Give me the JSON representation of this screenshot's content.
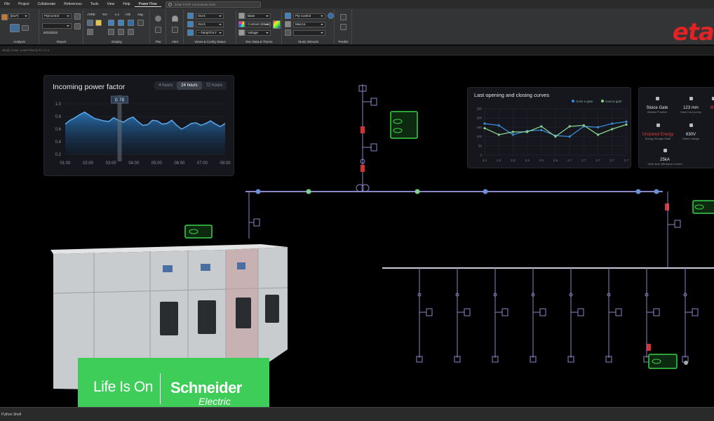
{
  "menu": [
    "File",
    "Project",
    "Collaborate",
    "References",
    "Tools",
    "View",
    "Help",
    "Power Flow"
  ],
  "command_search": {
    "placeholder": "Enter ETAP Commands Here"
  },
  "ribbon": {
    "analysis": {
      "dropdown": "[DLF]",
      "label": "Analysis"
    },
    "report": {
      "dropdown": "PQControl",
      "date": "9/22/2023",
      "label": "Report"
    },
    "display": {
      "items": [
        "√VRE",
        "%V",
        "L-L",
        "√Vb",
        "Avg"
      ],
      "label": "Display"
    },
    "plot": {
      "label": "Plot"
    },
    "alert": {
      "label": "Alert"
    },
    "views": {
      "dropdowns": [
        "OLV1",
        "OLV1",
        "---TampTOLY"
      ],
      "label": "Views & Config Status"
    },
    "rev": {
      "dropdowns": [
        "Base",
        "Contrast (Black)",
        "Voltage"
      ],
      "label": "Rev Data & Theme"
    },
    "study": {
      "dropdowns": [
        "PQ Control",
        "Macro1",
        ""
      ],
      "label": "Study Wizards"
    },
    "predict": {
      "label": "Predict"
    }
  },
  "logo": "eta",
  "substrip": "Study Case: Load Flow (LF) 1.3.1",
  "power_factor": {
    "title": "Incoming power factor",
    "tabs": [
      "4 hours",
      "24 hours",
      "72 hours"
    ],
    "active_tab": 1,
    "cursor_value": "0.78",
    "chart_data": {
      "type": "area",
      "x": [
        "01:00",
        "02:00",
        "03:00",
        "04:00",
        "05:00",
        "06:00",
        "07:00",
        "08:00"
      ],
      "y_ticks": [
        "1.0",
        "0.8",
        "0.6",
        "0.4",
        "0.2"
      ],
      "ylim": [
        0.2,
        1.0
      ],
      "values": [
        0.68,
        0.74,
        0.78,
        0.83,
        0.87,
        0.82,
        0.77,
        0.75,
        0.73,
        0.72,
        0.78,
        0.74,
        0.71,
        0.76,
        0.79,
        0.72,
        0.66,
        0.67,
        0.74,
        0.73,
        0.68,
        0.69,
        0.74,
        0.66,
        0.6,
        0.64,
        0.69,
        0.7,
        0.66,
        0.69,
        0.73,
        0.68,
        0.64,
        0.69
      ]
    }
  },
  "curves": {
    "title": "Last opening and closing curves",
    "legend": [
      "close a gate",
      "source gate"
    ],
    "colors": {
      "close": "#3b8bdc",
      "source": "#8ad48f"
    },
    "chart_data": {
      "type": "line",
      "x": [
        "2.1",
        "2.2",
        "2.3",
        "2.4",
        "2.5",
        "2.6",
        "2.7",
        "2.7",
        "2.7",
        "2.7",
        "2.7"
      ],
      "y_ticks": [
        "250",
        "200",
        "150",
        "100",
        "50",
        "0"
      ],
      "ylim": [
        0,
        250
      ],
      "series": [
        {
          "name": "close a gate",
          "values": [
            170,
            160,
            110,
            130,
            135,
            105,
            100,
            155,
            150,
            170,
            180
          ]
        },
        {
          "name": "source gate",
          "values": [
            145,
            110,
            125,
            125,
            155,
            100,
            155,
            160,
            110,
            140,
            165
          ]
        }
      ]
    }
  },
  "gate": {
    "items": [
      {
        "value": "Sluice Gate",
        "sub": "Breaker Position",
        "red": false
      },
      {
        "value": "123 mm",
        "sub": "Hand Car journey",
        "red": false
      },
      {
        "value": "MS",
        "sub": "",
        "red": true
      },
      {
        "value": "Unstored Energy",
        "sub": "Energy Storage State",
        "red": true
      },
      {
        "value": "630V",
        "sub": "Rated Voltage",
        "red": false
      },
      {
        "value": "25kA",
        "sub": "Short-time Withstand Current",
        "red": false
      }
    ]
  },
  "brand": {
    "tagline": "Life Is On",
    "name": "Schneider",
    "sub": "Electric"
  },
  "status": "Python Shell"
}
